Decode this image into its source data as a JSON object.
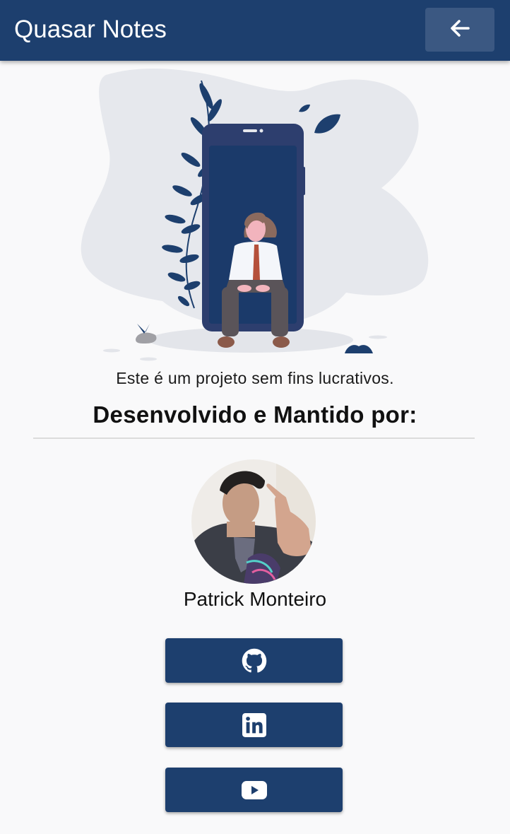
{
  "header": {
    "title": "Quasar Notes",
    "back_icon": "arrow-left-icon",
    "color": "#1d3f6e"
  },
  "about": {
    "illustration": "person-sitting-in-phone-illustration",
    "tagline": "Este é um projeto sem fins lucrativos.",
    "section_title": "Desenvolvido e Mantido por:"
  },
  "author": {
    "name": "Patrick Monteiro",
    "avatar": "author-photo"
  },
  "social": [
    {
      "icon": "github-icon"
    },
    {
      "icon": "linkedin-icon"
    },
    {
      "icon": "youtube-icon"
    }
  ]
}
